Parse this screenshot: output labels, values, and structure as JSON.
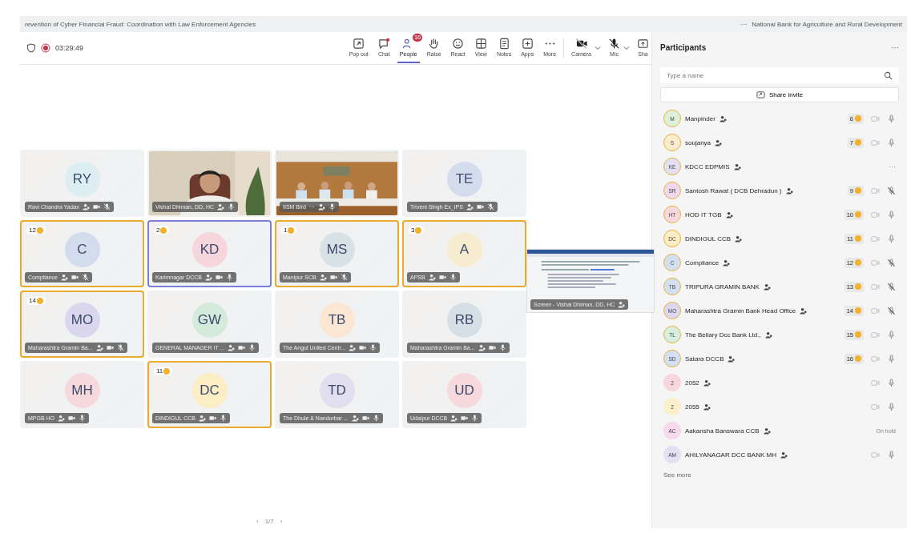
{
  "title_bar": {
    "meeting": "revention of Cyber Financial Fraud: Coordination with Law Enforcement Agencies",
    "more": "···",
    "organizer": "National Bank for Agriculture and Rural Development"
  },
  "timer": "03:29:49",
  "toolbar": [
    {
      "label": "Pop out",
      "selected": false
    },
    {
      "label": "Chat",
      "selected": false
    },
    {
      "label": "People",
      "selected": true,
      "badge": "16"
    },
    {
      "label": "Raise",
      "selected": false
    },
    {
      "label": "React",
      "selected": false
    },
    {
      "label": "View",
      "selected": false
    },
    {
      "label": "Notes",
      "selected": false
    },
    {
      "label": "Apps",
      "selected": false
    },
    {
      "label": "More",
      "selected": false
    },
    {
      "label": "Camera",
      "selected": false
    },
    {
      "label": "Mic",
      "selected": false
    },
    {
      "label": "Sha",
      "selected": false
    }
  ],
  "tiles": [
    {
      "kind": "avatar",
      "initials": "RY",
      "name": "Ravi Chandra Yadav",
      "color": "#dceef2",
      "active": false,
      "muted": true
    },
    {
      "kind": "video",
      "name": "Vishal Dhiman, DD, HC",
      "active": false,
      "muted": false
    },
    {
      "kind": "room",
      "name": "IISM Bird",
      "extra": "···",
      "active": false,
      "muted": false
    },
    {
      "kind": "avatar",
      "initials": "TE",
      "name": "Triveni Singh Ex_IPS",
      "color": "#d3dcec",
      "active": false,
      "muted": true
    },
    {
      "kind": "avatar",
      "initials": "C",
      "name": "Compliance",
      "color": "#d3dcec",
      "hand": "12",
      "active": false,
      "muted": true
    },
    {
      "kind": "avatar",
      "initials": "KD",
      "name": "Karimnagar DCCB",
      "color": "#f6d6dc",
      "hand": "2",
      "active": true,
      "muted": false
    },
    {
      "kind": "avatar",
      "initials": "MS",
      "name": "Manipur SCB",
      "color": "#d8e2e6",
      "hand": "1",
      "active": false,
      "muted": true
    },
    {
      "kind": "avatar",
      "initials": "A",
      "name": "APSB",
      "color": "#f8ecd0",
      "hand": "3",
      "active": false,
      "muted": false
    },
    {
      "kind": "avatar",
      "initials": "MO",
      "name": "Maharashtra Gramin Ba...",
      "color": "#d9d6ee",
      "hand": "14",
      "active": false,
      "muted": true
    },
    {
      "kind": "avatar",
      "initials": "GW",
      "name": "GENERAL MANAGER IT ...",
      "color": "#d4ebdc",
      "active": false,
      "muted": false
    },
    {
      "kind": "avatar",
      "initials": "TB",
      "name": "The Angul United Centr...",
      "color": "#fae6d2",
      "active": false,
      "muted": false
    },
    {
      "kind": "avatar",
      "initials": "RB",
      "name": "Maharashtra Gramin Ba...",
      "color": "#d7dfe6",
      "active": false,
      "muted": false
    },
    {
      "kind": "avatar",
      "initials": "MH",
      "name": "MPGB HO",
      "color": "#f6d9dd",
      "active": false,
      "muted": false
    },
    {
      "kind": "avatar",
      "initials": "DC",
      "name": "DINDIGUL CCB",
      "color": "#fbedc4",
      "hand": "11",
      "active": false,
      "muted": false
    },
    {
      "kind": "avatar",
      "initials": "TD",
      "name": "The Dhule & Nandurbar ...",
      "color": "#e1dfef",
      "active": false,
      "muted": false
    },
    {
      "kind": "avatar",
      "initials": "UD",
      "name": "Udaipur DCCB",
      "color": "#f6d9dc",
      "active": false,
      "muted": false
    }
  ],
  "screen_share": {
    "name": "Screen - Vishal Dhiman, DD, HC"
  },
  "pager": {
    "prev": "‹",
    "page": "1/7",
    "next": "›"
  },
  "participants": {
    "title": "Participants",
    "menu": "···",
    "search": {
      "placeholder": "Type a name"
    },
    "share": "Share invite",
    "items": [
      {
        "kind": "mic",
        "initials": "M",
        "name": "Manpinder",
        "color": "#dff0d8",
        "hand": "6",
        "muted": false
      },
      {
        "kind": "mic",
        "initials": "S",
        "name": "soujanya",
        "color": "#fbeccb",
        "hand": "7",
        "muted": false
      },
      {
        "kind": "more",
        "initials": "KE",
        "name": "KDCC EDPMIS",
        "color": "#e4e0f4",
        "hand_ring": true,
        "status_text": "···"
      },
      {
        "kind": "mic",
        "initials": "SR",
        "name": "Santosh Rawat ( DCB Dehradun )",
        "color": "#f0d8ee",
        "hand": "9",
        "muted": true
      },
      {
        "kind": "mic",
        "initials": "HT",
        "name": "HOD IT TGB",
        "color": "#f6d9e0",
        "hand": "10",
        "muted": false
      },
      {
        "kind": "mic",
        "initials": "DC",
        "name": "DINDIGUL CCB",
        "color": "#fbedc4",
        "hand": "11",
        "muted": false
      },
      {
        "kind": "mic",
        "initials": "C",
        "name": "Compliance",
        "color": "#d3e0f2",
        "hand": "12",
        "muted": true
      },
      {
        "kind": "mic",
        "initials": "TB",
        "name": "TRIPURA GRAMIN BANK",
        "color": "#d3e0f2",
        "hand": "13",
        "muted": true
      },
      {
        "kind": "mic",
        "initials": "MO",
        "name": "Maharashtra Gramin Bank Head Office",
        "color": "#ddd8f0",
        "hand": "14",
        "muted": true
      },
      {
        "kind": "mic",
        "initials": "TL",
        "name": "The Bellary Dcc Bank Ltd.,",
        "color": "#d8efe0",
        "hand": "15",
        "muted": false
      },
      {
        "kind": "mic",
        "initials": "SD",
        "name": "Satara DCCB",
        "color": "#d3dff2",
        "hand": "16",
        "muted": false
      },
      {
        "kind": "mic",
        "initials": "2",
        "name": "2052",
        "color": "#f8d6e0",
        "muted": false
      },
      {
        "kind": "mic",
        "initials": "2",
        "name": "2055",
        "color": "#fbefcc",
        "muted": false
      },
      {
        "kind": "hold",
        "initials": "AC",
        "name": "Aakansha Banswara CCB",
        "color": "#f6d9ec",
        "status_text": "On hold"
      },
      {
        "kind": "mic",
        "initials": "AM",
        "name": "AHILYANAGAR DCC BANK MH",
        "color": "#e3e0f4",
        "muted": false
      }
    ],
    "see_more": "See more"
  }
}
